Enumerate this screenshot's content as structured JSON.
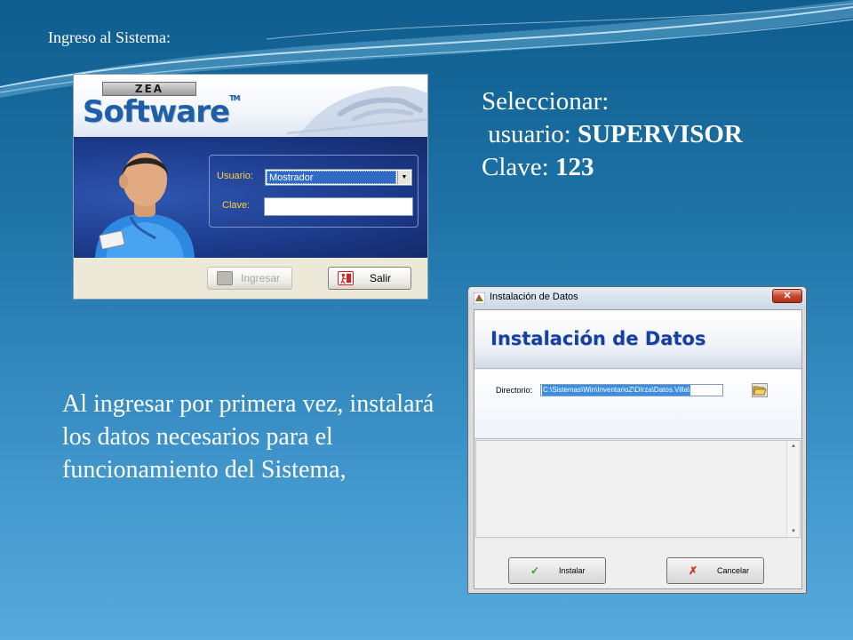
{
  "slide": {
    "title": "Ingreso al Sistema:",
    "instructions": {
      "line1": "Seleccionar:",
      "line2_prefix": " usuario: ",
      "line2_value": "SUPERVISOR",
      "line3_prefix": "Clave: ",
      "line3_value": "123"
    },
    "body": "Al ingresar por primera vez, instalará los datos necesarios para el funcionamiento del Sistema,"
  },
  "login": {
    "brand_plate": "ZEA",
    "brand_logo": "Software",
    "brand_tm": "TM",
    "usuario_label": "Usuario:",
    "usuario_value": "Mostrador",
    "clave_label": "Clave:",
    "clave_value": "",
    "ingresar_label": "Ingresar",
    "salir_label": "Salir",
    "icons": {
      "person": "user-avatar-icon",
      "dropdown": "chevron-down-icon",
      "ingresar": "key-icon",
      "salir": "exit-icon"
    },
    "colors": {
      "label": "#ffd23a",
      "body": "#1e3d8f",
      "selection": "#316ac5"
    }
  },
  "install": {
    "window_title": "Instalación de Datos",
    "close_label": "✕",
    "heading": "Instalación de Datos",
    "directorio_label": "Directorio:",
    "directorio_value": "C:\\Sistemas\\Win\\InventarioZ\\DIrza\\Datos.Villa\\",
    "instalar_label": "Instalar",
    "cancelar_label": "Cancelar",
    "icons": {
      "app": "app-icon",
      "folder": "open-folder-icon",
      "instalar": "checkmark-icon",
      "cancelar": "red-x-icon"
    },
    "colors": {
      "heading": "#1440a0",
      "close": "#c9462c"
    }
  }
}
